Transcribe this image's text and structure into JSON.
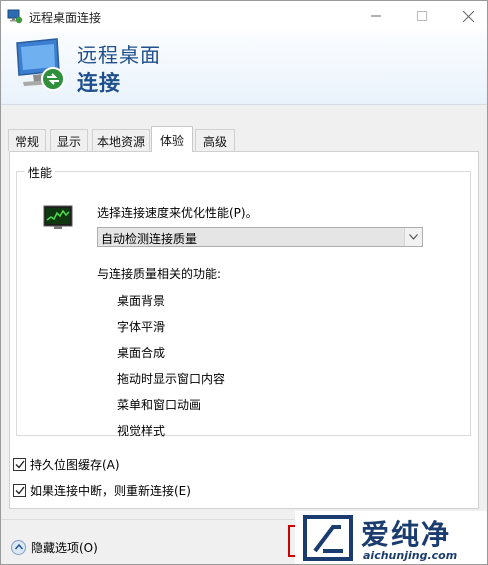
{
  "window": {
    "title": "远程桌面连接"
  },
  "banner": {
    "line1": "远程桌面",
    "line2": "连接"
  },
  "tabs": [
    {
      "label": "常规"
    },
    {
      "label": "显示"
    },
    {
      "label": "本地资源"
    },
    {
      "label": "体验",
      "active": true
    },
    {
      "label": "高级"
    }
  ],
  "performance": {
    "group_title": "性能",
    "select_label": "选择连接速度来优化性能(P)。",
    "select_value": "自动检测连接质量",
    "features_label": "与连接质量相关的功能:",
    "features": [
      "桌面背景",
      "字体平滑",
      "桌面合成",
      "拖动时显示窗口内容",
      "菜单和窗口动画",
      "视觉样式"
    ]
  },
  "checkboxes": [
    {
      "label": "持久位图缓存(A)",
      "checked": true
    },
    {
      "label": "如果连接中断，则重新连接(E)",
      "checked": true
    }
  ],
  "footer": {
    "hide_options": "隐藏选项(O)"
  },
  "watermark": {
    "title": "爱纯净",
    "url": "aichunjing.com"
  },
  "colors": {
    "banner_text": "#1e4f8c",
    "watermark": "#1a3c6e",
    "highlight": "#cc0000"
  }
}
